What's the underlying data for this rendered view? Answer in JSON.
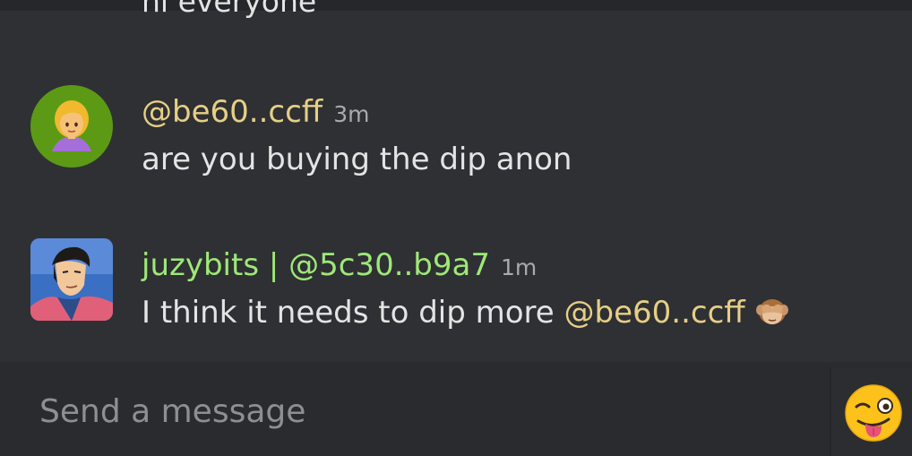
{
  "chat": {
    "partial_message": {
      "text": "hi everyone"
    },
    "messages": [
      {
        "author": "@be60..ccff",
        "time": "3m",
        "body": "are you buying the dip anon",
        "avatar_icon": "woman-emoji-avatar",
        "avatar_color": "#5c9a16",
        "author_color": "#e6cf86"
      },
      {
        "author": "juzybits | @5c30..b9a7",
        "time": "1m",
        "body": "I think it needs to dip more",
        "mention": "@be60..ccff",
        "inline_emoji": "see-no-evil-monkey-emoji",
        "avatar_icon": "cartoon-character-avatar",
        "author_color": "#9ee878"
      }
    ]
  },
  "composer": {
    "placeholder": "Send a message",
    "emoji_button_icon": "winking-tongue-face-emoji"
  }
}
